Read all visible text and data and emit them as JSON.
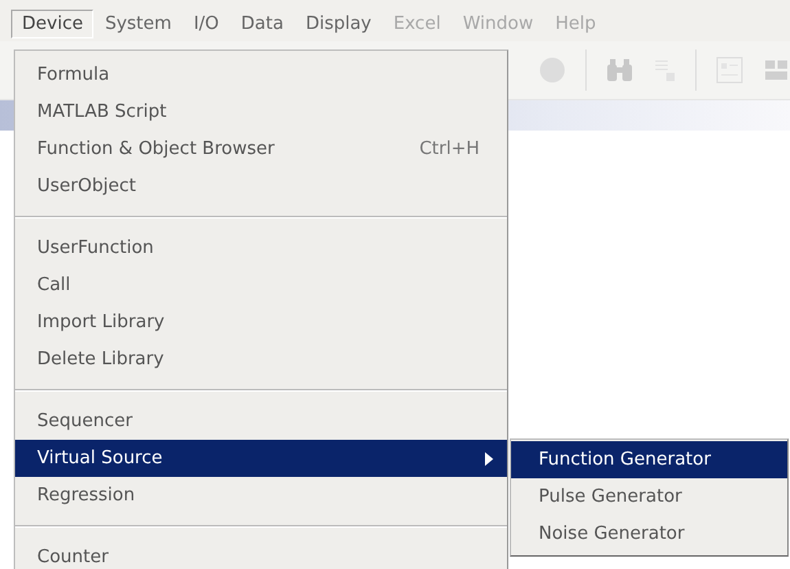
{
  "menu_bar": [
    {
      "label": "Device",
      "selected": true,
      "disabled": false
    },
    {
      "label": "System",
      "selected": false,
      "disabled": false
    },
    {
      "label": "I/O",
      "selected": false,
      "disabled": false
    },
    {
      "label": "Data",
      "selected": false,
      "disabled": false
    },
    {
      "label": "Display",
      "selected": false,
      "disabled": false
    },
    {
      "label": "Excel",
      "selected": false,
      "disabled": true
    },
    {
      "label": "Window",
      "selected": false,
      "disabled": true
    },
    {
      "label": "Help",
      "selected": false,
      "disabled": true
    }
  ],
  "device_menu": {
    "sections": [
      {
        "items": [
          {
            "label": "Formula",
            "selected": false,
            "submenu": false
          },
          {
            "label": "MATLAB Script",
            "selected": false,
            "submenu": false
          },
          {
            "label": "Function & Object Browser",
            "shortcut": "Ctrl+H",
            "selected": false,
            "submenu": false
          },
          {
            "label": "UserObject",
            "selected": false,
            "submenu": false
          }
        ]
      },
      {
        "items": [
          {
            "label": "UserFunction",
            "selected": false,
            "submenu": false
          },
          {
            "label": "Call",
            "selected": false,
            "submenu": false
          },
          {
            "label": "Import Library",
            "selected": false,
            "submenu": false
          },
          {
            "label": "Delete Library",
            "selected": false,
            "submenu": false
          }
        ]
      },
      {
        "items": [
          {
            "label": "Sequencer",
            "selected": false,
            "submenu": false
          },
          {
            "label": "Virtual Source",
            "selected": true,
            "submenu": true
          },
          {
            "label": "Regression",
            "selected": false,
            "submenu": false
          }
        ]
      },
      {
        "items": [
          {
            "label": "Counter",
            "selected": false,
            "submenu": false
          }
        ]
      }
    ]
  },
  "virtual_source_submenu": {
    "items": [
      {
        "label": "Function Generator",
        "selected": true
      },
      {
        "label": "Pulse Generator",
        "selected": false
      },
      {
        "label": "Noise Generator",
        "selected": false
      }
    ]
  }
}
